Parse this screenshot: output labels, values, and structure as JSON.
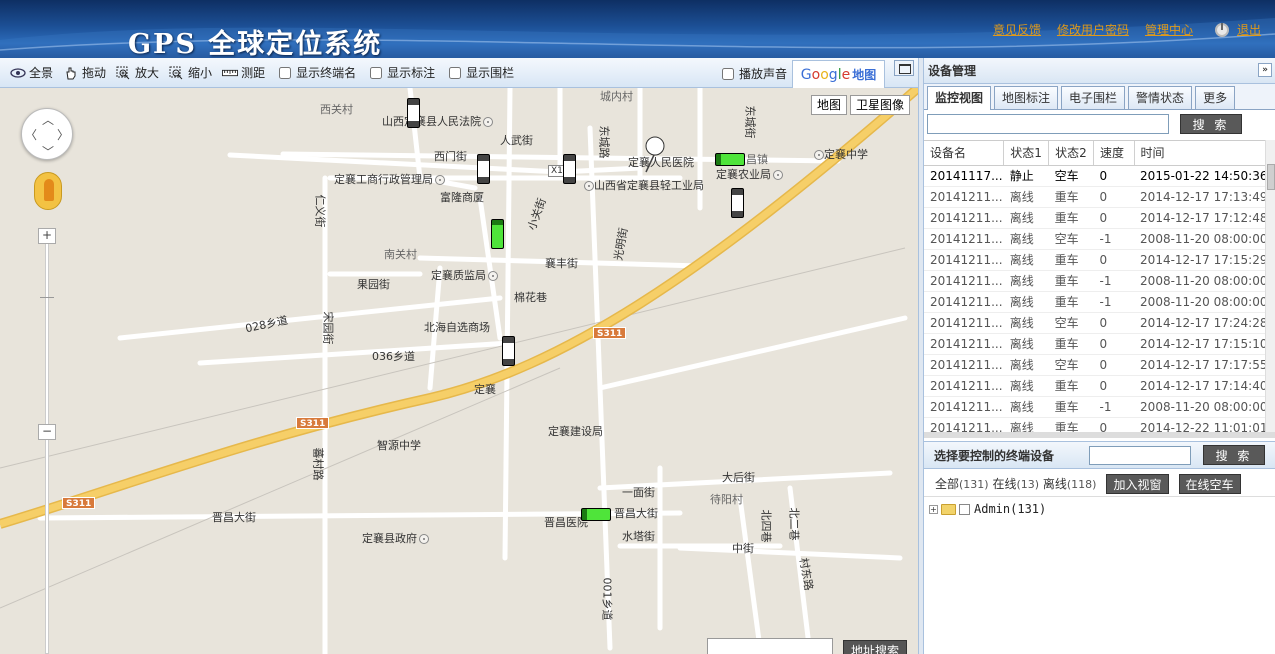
{
  "header": {
    "title": "GPS 全球定位系统",
    "links": [
      "意见反馈",
      "修改用户密码",
      "管理中心"
    ],
    "logout": "退出"
  },
  "toolbar": {
    "tools": [
      {
        "label": "全景",
        "icon": "eye-icon"
      },
      {
        "label": "拖动",
        "icon": "hand-icon"
      },
      {
        "label": "放大",
        "icon": "zoom-in-icon"
      },
      {
        "label": "缩小",
        "icon": "zoom-out-icon"
      },
      {
        "label": "测距",
        "icon": "ruler-icon"
      }
    ],
    "checks": [
      "显示终端名",
      "显示标注",
      "显示围栏"
    ],
    "sound": "播放声音",
    "map_tab": "地图"
  },
  "map": {
    "type_buttons": [
      "地图",
      "卫星图像"
    ],
    "labels": [
      "山西定襄县人民法院",
      "西关村",
      "城内村",
      "西门街",
      "人武街",
      "东城路",
      "东城街",
      "定襄人民医院",
      "昌镇",
      "定襄中学",
      "定襄工商行政管理局",
      "X1",
      "山西省定襄县轻工业局",
      "定襄农业局",
      "富隆商厦",
      "仁义街",
      "小关街",
      "南关村",
      "襄丰街",
      "光明街",
      "定襄质监局",
      "果园街",
      "棉花巷",
      "028乡道",
      "北海自选商场",
      "宋园街",
      "036乡道",
      "S311",
      "定襄",
      "智源中学",
      "定襄建设局",
      "蕃村路",
      "大后街",
      "一面街",
      "待阳村",
      "北四巷",
      "北二巷",
      "晋昌大街",
      "晋昌医院",
      "水塔街",
      "定襄县政府",
      "中街",
      "村东路",
      "001乡道"
    ],
    "search_button": "地址搜索"
  },
  "panel": {
    "title": "设备管理",
    "tabs": [
      "监控视图",
      "地图标注",
      "电子围栏",
      "警情状态",
      "更多"
    ],
    "search_button": "搜 索",
    "columns": [
      "设备名",
      "状态1",
      "状态2",
      "速度",
      "时间"
    ],
    "rows": [
      [
        "20141117...",
        "静止",
        "空车",
        "0",
        "2015-01-22 14:50:36"
      ],
      [
        "20141211...",
        "离线",
        "重车",
        "0",
        "2014-12-17 17:13:49"
      ],
      [
        "20141211...",
        "离线",
        "重车",
        "0",
        "2014-12-17 17:12:48"
      ],
      [
        "20141211...",
        "离线",
        "空车",
        "-1",
        "2008-11-20 08:00:00"
      ],
      [
        "20141211...",
        "离线",
        "重车",
        "0",
        "2014-12-17 17:15:29"
      ],
      [
        "20141211...",
        "离线",
        "重车",
        "-1",
        "2008-11-20 08:00:00"
      ],
      [
        "20141211...",
        "离线",
        "重车",
        "-1",
        "2008-11-20 08:00:00"
      ],
      [
        "20141211...",
        "离线",
        "空车",
        "0",
        "2014-12-17 17:24:28"
      ],
      [
        "20141211...",
        "离线",
        "重车",
        "0",
        "2014-12-17 17:15:10"
      ],
      [
        "20141211...",
        "离线",
        "空车",
        "0",
        "2014-12-17 17:17:55"
      ],
      [
        "20141211...",
        "离线",
        "重车",
        "0",
        "2014-12-17 17:14:40"
      ],
      [
        "20141211...",
        "离线",
        "重车",
        "-1",
        "2008-11-20 08:00:00"
      ],
      [
        "20141211...",
        "离线",
        "重车",
        "0",
        "2014-12-22 11:01:01"
      ]
    ],
    "select": {
      "title": "选择要控制的终端设备",
      "search_button": "搜 索",
      "stats": {
        "all": "全部",
        "all_count": "(131)",
        "online": "在线",
        "online_count": "(13)",
        "offline": "离线",
        "offline_count": "(118)"
      },
      "add_button": "加入视窗",
      "online_empty_button": "在线空车",
      "tree_root": "Admin(131)"
    }
  },
  "colors": {
    "header": "#1c4f95",
    "link": "#e09a1a",
    "highway": "#f6cf68",
    "vehicle_green": "#4fe43a"
  }
}
